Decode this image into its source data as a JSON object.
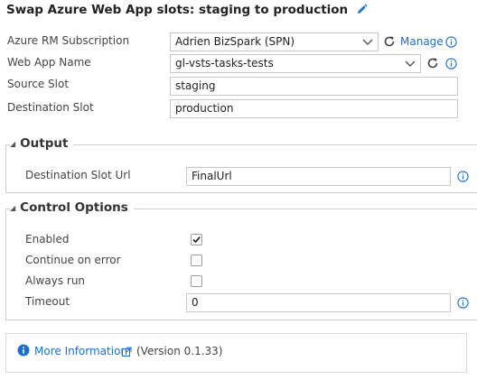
{
  "header": {
    "title": "Swap Azure Web App slots: staging to production"
  },
  "main": {
    "subscription": {
      "label": "Azure RM Subscription",
      "value": "Adrien BizSpark (SPN)",
      "manage_label": "Manage"
    },
    "webapp": {
      "label": "Web App Name",
      "value": "gl-vsts-tasks-tests"
    },
    "source_slot": {
      "label": "Source Slot",
      "value": "staging"
    },
    "destination_slot": {
      "label": "Destination Slot",
      "value": "production"
    }
  },
  "output": {
    "title": "Output",
    "destination_url": {
      "label": "Destination Slot Url",
      "value": "FinalUrl"
    }
  },
  "control": {
    "title": "Control Options",
    "enabled": {
      "label": "Enabled",
      "checked": true
    },
    "continue_on_error": {
      "label": "Continue on error",
      "checked": false
    },
    "always_run": {
      "label": "Always run",
      "checked": false
    },
    "timeout": {
      "label": "Timeout",
      "value": "0"
    }
  },
  "footer": {
    "more_info": "More Information",
    "version": "(Version 0.1.33)"
  },
  "colors": {
    "accent": "#1e6fc7",
    "border": "#c8c8c8",
    "text": "#333333"
  },
  "icons": [
    "pencil-icon",
    "chevron-down-icon",
    "refresh-icon",
    "info-icon",
    "external-link-icon",
    "checkmark-icon"
  ]
}
